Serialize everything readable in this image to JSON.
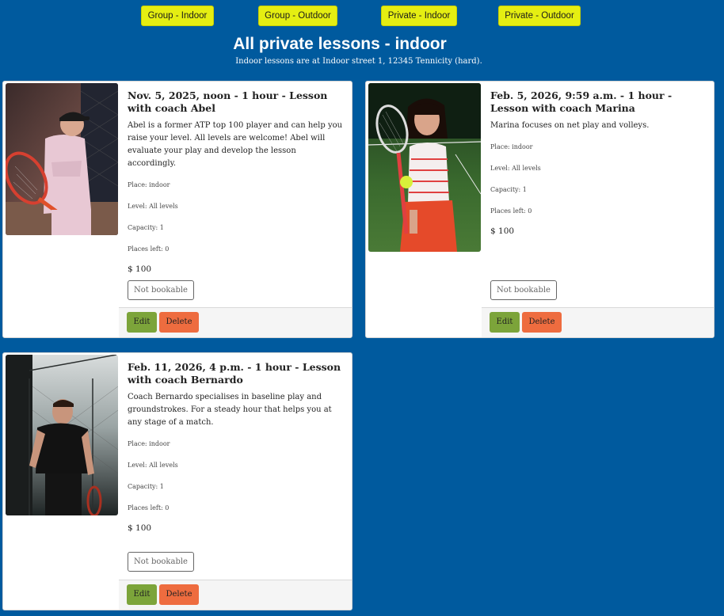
{
  "nav": [
    {
      "label": "Group - Indoor"
    },
    {
      "label": "Group - Outdoor"
    },
    {
      "label": "Private - Indoor"
    },
    {
      "label": "Private - Outdoor"
    }
  ],
  "hero": {
    "title": "All private lessons - indoor",
    "subtitle": "Indoor lessons are at Indoor street 1, 12345 Tennicity (hard)."
  },
  "lessons": [
    {
      "title": "Nov. 5, 2025, noon - 1 hour - Lesson with coach Abel",
      "description": "Abel is a former ATP top 100 player and can help you raise your level. All levels are welcome! Abel will evaluate your play and develop the lesson accordingly.",
      "place": "Place: indoor",
      "level": "Level: All levels",
      "capacity": "Capacity: 1",
      "places_left": "Places left: 0",
      "price": "$ 100",
      "status_label": "Not bookable",
      "edit_label": "Edit",
      "delete_label": "Delete",
      "photo_icon": "coach-photo"
    },
    {
      "title": "Feb. 5, 2026, 9:59 a.m. - 1 hour - Lesson with coach Marina",
      "description": "Marina focuses on net play and volleys.",
      "place": "Place: indoor",
      "level": "Level: All levels",
      "capacity": "Capacity: 1",
      "places_left": "Places left: 0",
      "price": "$ 100",
      "status_label": "Not bookable",
      "edit_label": "Edit",
      "delete_label": "Delete",
      "photo_icon": "coach-photo"
    },
    {
      "title": "Feb. 11, 2026, 4 p.m. - 1 hour - Lesson with coach Bernardo",
      "description": "Coach Bernardo specialises in baseline play and groundstrokes. For a steady hour that helps you at any stage of a match.",
      "place": "Place: indoor",
      "level": "Level: All levels",
      "capacity": "Capacity: 1",
      "places_left": "Places left: 0",
      "price": "$ 100",
      "status_label": "Not bookable",
      "edit_label": "Edit",
      "delete_label": "Delete",
      "photo_icon": "coach-photo"
    }
  ],
  "colors": {
    "page_bg": "#005a9e",
    "nav_button": "#e5ee12",
    "edit_button": "#7ca43a",
    "delete_button": "#ee6c3f"
  }
}
